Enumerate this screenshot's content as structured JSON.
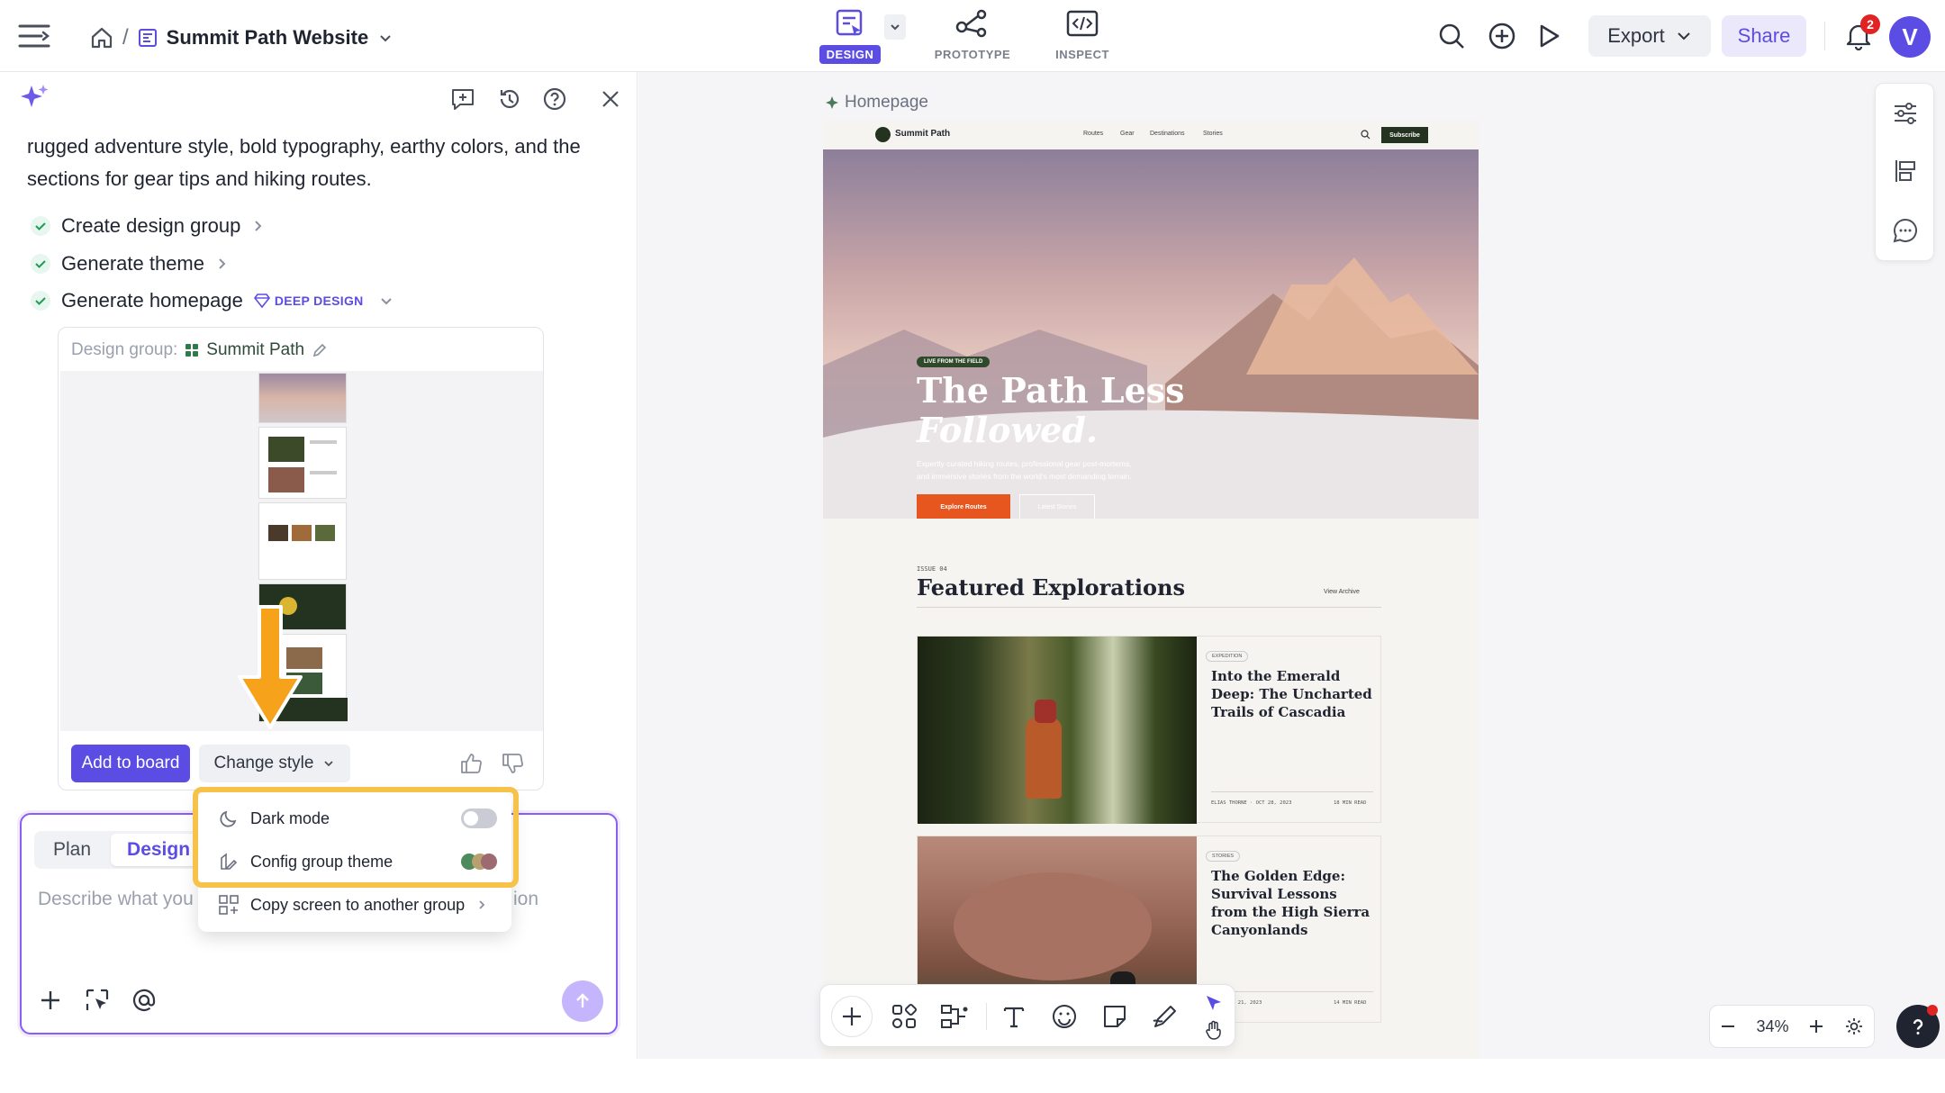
{
  "header": {
    "project_title": "Summit Path Website",
    "modes": [
      {
        "label": "DESIGN",
        "active": true
      },
      {
        "label": "PROTOTYPE",
        "active": false
      },
      {
        "label": "INSPECT",
        "active": false
      }
    ],
    "export_label": "Export",
    "share_label": "Share",
    "notification_count": "2",
    "avatar_letter": "V",
    "accent": "#5b4de3"
  },
  "chat": {
    "message": "rugged adventure style, bold typography, earthy colors, and the sections for gear tips and hiking routes.",
    "steps": [
      {
        "label": "Create design group"
      },
      {
        "label": "Generate theme"
      },
      {
        "label": "Generate homepage",
        "badge": "DEEP DESIGN"
      }
    ],
    "group_label": "Design group:",
    "group_name": "Summit Path",
    "add_to_board": "Add to board",
    "change_style": "Change style"
  },
  "menu": {
    "dark_mode": "Dark mode",
    "config_theme": "Config group theme",
    "copy_screen": "Copy screen to another group"
  },
  "composer": {
    "tab_plan": "Plan",
    "tab_design": "Design",
    "placeholder_left": "Describe what you",
    "placeholder_right": "ion"
  },
  "canvas": {
    "frame_label": "Homepage",
    "zoom": "34%"
  },
  "site": {
    "brand": "Summit Path",
    "nav": [
      "Routes",
      "Gear",
      "Destinations",
      "Stories"
    ],
    "subscribe": "Subscribe",
    "hero_tag": "LIVE FROM THE FIELD",
    "hero_title_1": "The Path Less",
    "hero_title_2": "Followed.",
    "hero_sub_1": "Expertly curated hiking routes, professional gear post-mortems,",
    "hero_sub_2": "and immersive stories from the world's most demanding terrain.",
    "cta_primary": "Explore Routes",
    "cta_secondary": "Latest Stories",
    "issue": "ISSUE 04",
    "section_title": "Featured Explorations",
    "view_archive": "View Archive",
    "cards": [
      {
        "tag": "EXPEDITION",
        "title": "Into the Emerald Deep: The Uncharted Trails of Cascadia",
        "author": "ELIAS THORNE · OCT 28, 2023",
        "read": "18 MIN READ"
      },
      {
        "tag": "STORIES",
        "title": "The Golden Edge: Survival Lessons from the High Sierra Canyonlands",
        "author": "EN · OCT 21, 2023",
        "read": "14 MIN READ"
      }
    ]
  }
}
